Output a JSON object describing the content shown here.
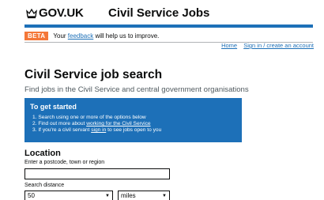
{
  "header": {
    "brand": "GOV.UK",
    "service": "Civil Service Jobs",
    "crown_icon": "crown-icon"
  },
  "beta": {
    "tag": "BETA",
    "text_before": "Your ",
    "feedback_link": "feedback",
    "text_after": " will help us to improve."
  },
  "nav_links": {
    "home": "Home",
    "signin": "Sign in / create an account"
  },
  "page": {
    "title": "Civil Service job search",
    "subtitle": "Find jobs in the Civil Service and central government organisations"
  },
  "panel": {
    "title": "To get started",
    "step1": "1. Search using one or more of the options below",
    "step2_before": "2. Find out more about ",
    "step2_link": "working for the Civil Service",
    "step3_before": "3. If you're a civil servant ",
    "step3_link": "sign in",
    "step3_after": " to see jobs open to you"
  },
  "location": {
    "heading": "Location",
    "hint": "Enter a postcode, town or region",
    "value": "",
    "distance_label": "Search distance",
    "distance_value": "50",
    "unit_value": "miles"
  },
  "colors": {
    "brand_blue": "#1d70b8",
    "beta_orange": "#f47738",
    "text": "#0b0c0c",
    "secondary_text": "#505a5f"
  }
}
